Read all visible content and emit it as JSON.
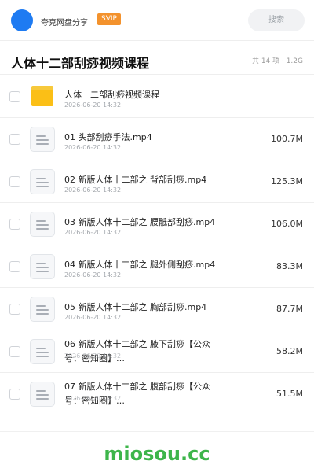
{
  "header": {
    "share_name": "夸克网盘分享",
    "badge": "SVIP",
    "search_placeholder": "搜索"
  },
  "folder": {
    "title": "人体十二部刮痧视频课程",
    "meta": "共 14 项 · 1.2G"
  },
  "items": [
    {
      "type": "folder",
      "name": "人体十二部刮痧视频课程",
      "date": "2026-06-20 14:32",
      "size": ""
    },
    {
      "type": "file",
      "name": "01 头部刮痧手法.mp4",
      "date": "2026-06-20 14:32",
      "size": "100.7M"
    },
    {
      "type": "file",
      "name": "02 新版人体十二部之 背部刮痧.mp4",
      "date": "2026-06-20 14:32",
      "size": "125.3M"
    },
    {
      "type": "file",
      "name": "03 新版人体十二部之 腰骶部刮痧.mp4",
      "date": "2026-06-20 14:32",
      "size": "106.0M"
    },
    {
      "type": "file",
      "name": "04 新版人体十二部之 腿外侧刮痧.mp4",
      "date": "2026-06-20 14:32",
      "size": "83.3M"
    },
    {
      "type": "file",
      "name": "05 新版人体十二部之 胸部刮痧.mp4",
      "date": "2026-06-20 14:32",
      "size": "87.7M"
    },
    {
      "type": "file",
      "name": "06 新版人体十二部之 腋下刮痧【公众号：密知圈】…",
      "date": "2026-06-20 14:32",
      "size": "58.2M"
    },
    {
      "type": "file",
      "name": "07 新版人体十二部之 腹部刮痧【公众号：密知圈】…",
      "date": "2026-06-20 14:32",
      "size": "51.5M"
    }
  ],
  "footer": {
    "watermark": "miosou.cc"
  },
  "colors": {
    "accent": "#1e7bf2",
    "svip": "#f3922d",
    "folder": "#fbbf16",
    "watermark": "#3db54a"
  }
}
